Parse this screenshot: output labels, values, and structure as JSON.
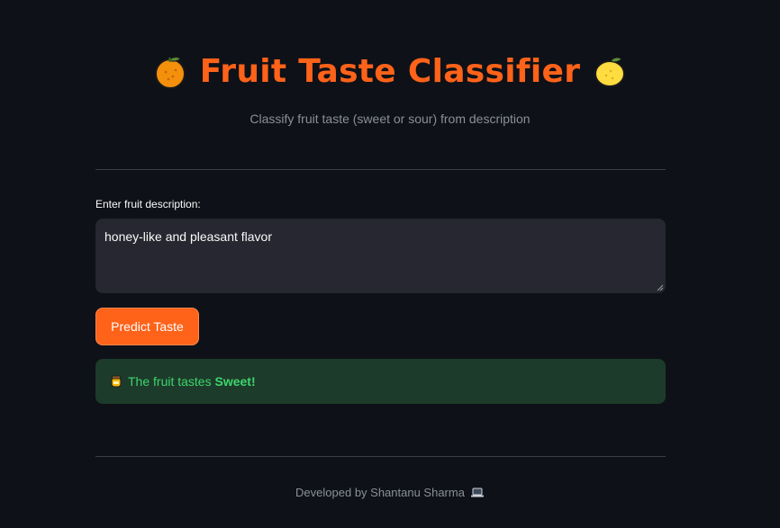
{
  "header": {
    "title": "Fruit Taste Classifier",
    "left_icon": "orange-fruit-icon",
    "right_icon": "lemon-icon",
    "subtitle": "Classify fruit taste (sweet or sour) from description"
  },
  "form": {
    "label": "Enter fruit description:",
    "value": "honey-like and pleasant flavor"
  },
  "button": {
    "label": "Predict Taste"
  },
  "result": {
    "icon": "honey-pot-icon",
    "prefix": "The fruit tastes ",
    "value": "Sweet!"
  },
  "footer": {
    "text": "Developed by Shantanu Sharma",
    "icon": "laptop-icon"
  },
  "colors": {
    "background": "#0e1117",
    "accent": "#ff6219",
    "success_bg": "#1d3b2a",
    "success_text": "#3dd56d"
  }
}
